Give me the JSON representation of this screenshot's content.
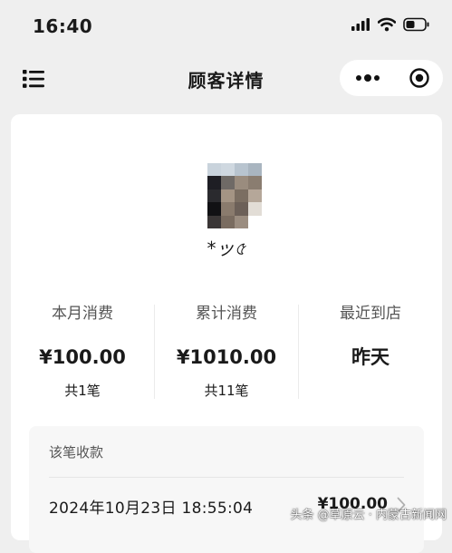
{
  "status_bar": {
    "time": "16:40"
  },
  "nav": {
    "title": "顾客详情"
  },
  "customer": {
    "nickname": "*ッ৫"
  },
  "stats": [
    {
      "label": "本月消费",
      "value": "¥100.00",
      "count": "共1笔"
    },
    {
      "label": "累计消费",
      "value": "¥1010.00",
      "count": "共11笔"
    },
    {
      "label": "最近到店",
      "value": "昨天",
      "count": ""
    }
  ],
  "receipt": {
    "title": "该笔收款",
    "time": "2024年10月23日 18:55:04",
    "amount": "¥100.00"
  },
  "watermark": "头条 @草原云 · 内蒙古新闻网",
  "colors": {
    "page_bg": "#efefef",
    "card_bg": "#ffffff",
    "receipt_bg": "#f7f7f7",
    "muted_text": "#555555"
  },
  "icons": [
    "signal-icon",
    "wifi-icon",
    "battery-icon",
    "menu-list-icon",
    "more-dots-icon",
    "target-icon",
    "chevron-right-icon"
  ]
}
